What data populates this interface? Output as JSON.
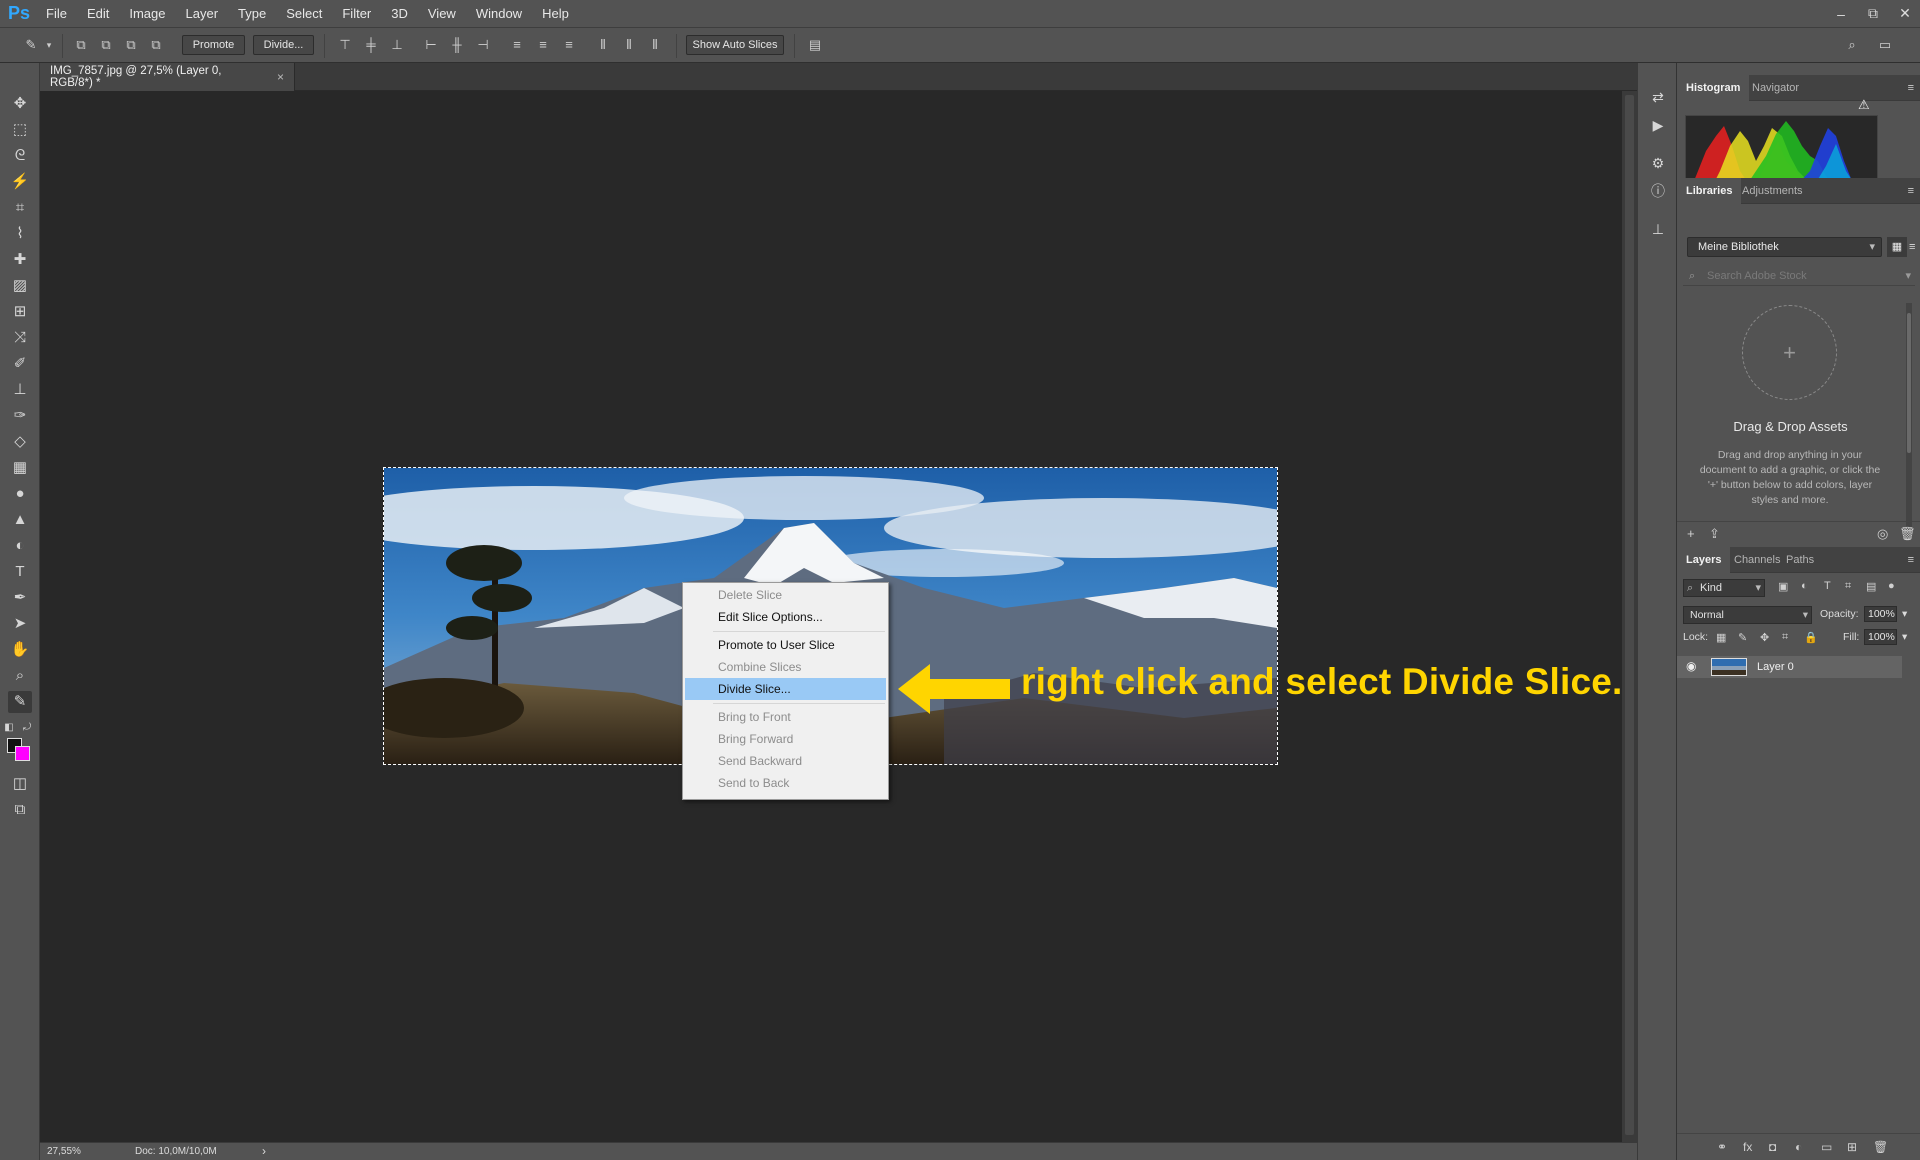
{
  "menubar": {
    "logo": "Ps",
    "items": [
      "File",
      "Edit",
      "Image",
      "Layer",
      "Type",
      "Select",
      "Filter",
      "3D",
      "View",
      "Window",
      "Help"
    ],
    "window_controls": {
      "minimize": "–",
      "restore": "⧉",
      "close": "✕"
    }
  },
  "options_bar": {
    "promote_label": "Promote",
    "divide_label": "Divide...",
    "auto_slices_label": "Show Auto Slices"
  },
  "document": {
    "tab_title": "IMG_7857.jpg @ 27,5% (Layer 0, RGB/8*) *",
    "close_glyph": "×"
  },
  "context_menu": {
    "items": [
      {
        "label": "Delete Slice",
        "enabled": false
      },
      {
        "label": "Edit Slice Options...",
        "enabled": true
      },
      {
        "label": "Promote to User Slice",
        "enabled": true
      },
      {
        "label": "Combine Slices",
        "enabled": false
      },
      {
        "label": "Divide Slice...",
        "enabled": true,
        "selected": true
      },
      {
        "label": "Bring to Front",
        "enabled": false
      },
      {
        "label": "Bring Forward",
        "enabled": false
      },
      {
        "label": "Send Backward",
        "enabled": false
      },
      {
        "label": "Send to Back",
        "enabled": false
      }
    ]
  },
  "annotation": {
    "text": "right click and select Divide Slice...",
    "color": "#ffd500"
  },
  "status_bar": {
    "zoom": "27,55%",
    "doc_size": "Doc: 10,0M/10,0M",
    "arrow": "›"
  },
  "panels": {
    "histogram_tabs": [
      "Histogram",
      "Navigator"
    ],
    "library_tabs": [
      "Libraries",
      "Adjustments"
    ],
    "library_name": "Meine Bibliothek",
    "stock_search_placeholder": "Search Adobe Stock",
    "drop_plus": "+",
    "drop_title": "Drag & Drop Assets",
    "drop_description": "Drag and drop anything in your document to add a graphic, or click the '+' button below to add colors, layer styles and more.",
    "layers_tabs": [
      "Layers",
      "Channels",
      "Paths"
    ],
    "kind_label": "Kind",
    "blend_mode": "Normal",
    "opacity_label": "Opacity:",
    "opacity_value": "100%",
    "lock_label": "Lock:",
    "fill_label": "Fill:",
    "fill_value": "100%",
    "layer_name": "Layer 0"
  },
  "colors": {
    "foreground": "#111111",
    "background": "#ff00ff",
    "selection_highlight": "#99c9f5",
    "ps_blue": "#31a8ff"
  }
}
